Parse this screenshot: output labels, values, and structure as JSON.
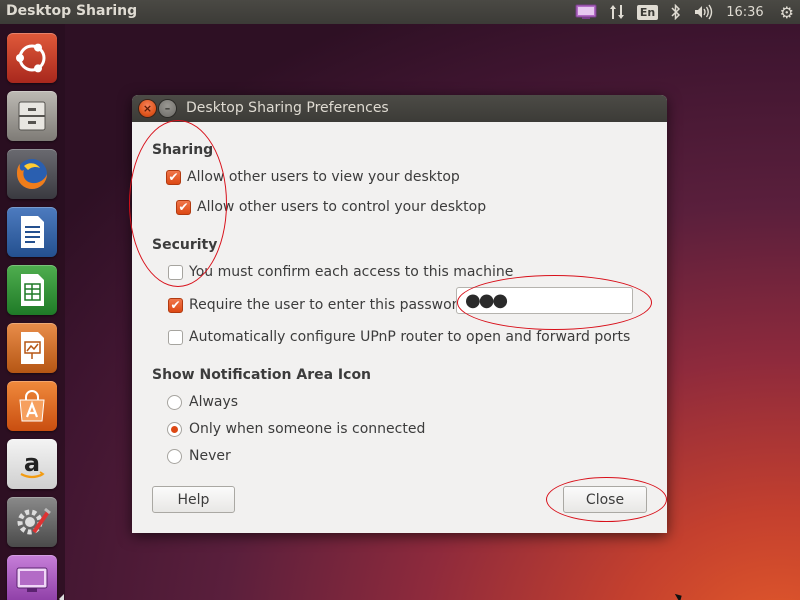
{
  "panel": {
    "app_title": "Desktop Sharing",
    "indicators": {
      "desktop_sharing_icon": "screen-share-icon",
      "network_icon": "network-arrows-icon",
      "language": "En",
      "bluetooth_icon": "bluetooth-icon",
      "volume_icon": "volume-icon",
      "time": "16:36",
      "settings_icon": "gear-icon"
    }
  },
  "launcher": {
    "items": [
      "ubuntu-dash",
      "files",
      "firefox",
      "libreoffice-writer",
      "libreoffice-calc",
      "libreoffice-impress",
      "ubuntu-software-center",
      "amazon",
      "system-settings",
      "desktop-sharing"
    ]
  },
  "dialog": {
    "title": "Desktop Sharing Preferences",
    "sharing": {
      "heading": "Sharing",
      "allow_view": {
        "label": "Allow other users to view your desktop",
        "checked": true
      },
      "allow_control": {
        "label": "Allow other users to control your desktop",
        "checked": true
      }
    },
    "security": {
      "heading": "Security",
      "confirm_access": {
        "label": "You must confirm each access to this machine",
        "checked": false
      },
      "require_password": {
        "label": "Require the user to enter this password:",
        "checked": true
      },
      "password_value": "●●●",
      "upnp": {
        "label": "Automatically configure UPnP router to open and forward ports",
        "checked": false
      }
    },
    "notification": {
      "heading": "Show Notification Area Icon",
      "options": [
        "Always",
        "Only when someone is connected",
        "Never"
      ],
      "selected": "Only when someone is connected"
    },
    "help_label": "Help",
    "close_label": "Close"
  },
  "colors": {
    "accent": "#dd4814",
    "annotation": "#d8101a",
    "panel": "#3c3b37"
  }
}
